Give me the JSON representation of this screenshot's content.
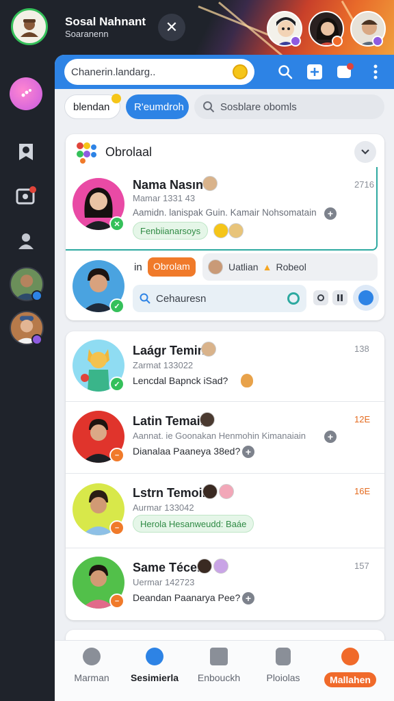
{
  "header": {
    "title": "Sosal Nahnant",
    "subtitle": "Soaranenn",
    "close_icon": "close-icon"
  },
  "search": {
    "placeholder": "Chanerin.landarg.."
  },
  "filters": {
    "chip_a": "blendan",
    "chip_b": "R'eumdroh",
    "search_placeholder": "Sosblare obomls"
  },
  "group": {
    "title": "Obrolaal",
    "chat": {
      "name": "Nama Nasın",
      "meta": "Mamar 1331 43",
      "message": "Aamidn. lanispak Guin. Kamair Nohsomatain",
      "tag": "Fenbiianarsoys",
      "time": "2716"
    },
    "compose": {
      "prefix": "in",
      "chip": "Obrolam",
      "label": "Uatlian",
      "label2": "Robeol",
      "input_placeholder": "Cehauresn"
    }
  },
  "chats": [
    {
      "name": "Laágr Temin",
      "meta": "Zarmat 133022",
      "message": "Lencdal Bapnck iSad?",
      "time": "138",
      "accent": "#35c05a"
    },
    {
      "name": "Latin Temain",
      "meta": "Aannat. ie Goonakan Henmohin Kimanaiain",
      "message": "Dianalaa Paaneya 38ed?",
      "time": "12E",
      "accent": "#f07a2a"
    },
    {
      "name": "Lstrn Temoin",
      "meta": "Aurmar 133042",
      "message": "Herola Hesanweudd: Baáe",
      "time": "16E",
      "accent": "#f07a2a"
    },
    {
      "name": "Same Técen",
      "meta": "Uermar 142723",
      "message": "Deandan Paanarya Pee?",
      "time": "157",
      "accent": "#f07a2a"
    }
  ],
  "bottom_nav": [
    {
      "label": "Marman"
    },
    {
      "label": "Sesimierla"
    },
    {
      "label": "Enbouckh"
    },
    {
      "label": "Ploiolas"
    },
    {
      "label": "Mallahen"
    }
  ],
  "colors": {
    "primary": "#2d83e5",
    "accent_orange": "#f06a2a",
    "online_green": "#35c05a"
  }
}
